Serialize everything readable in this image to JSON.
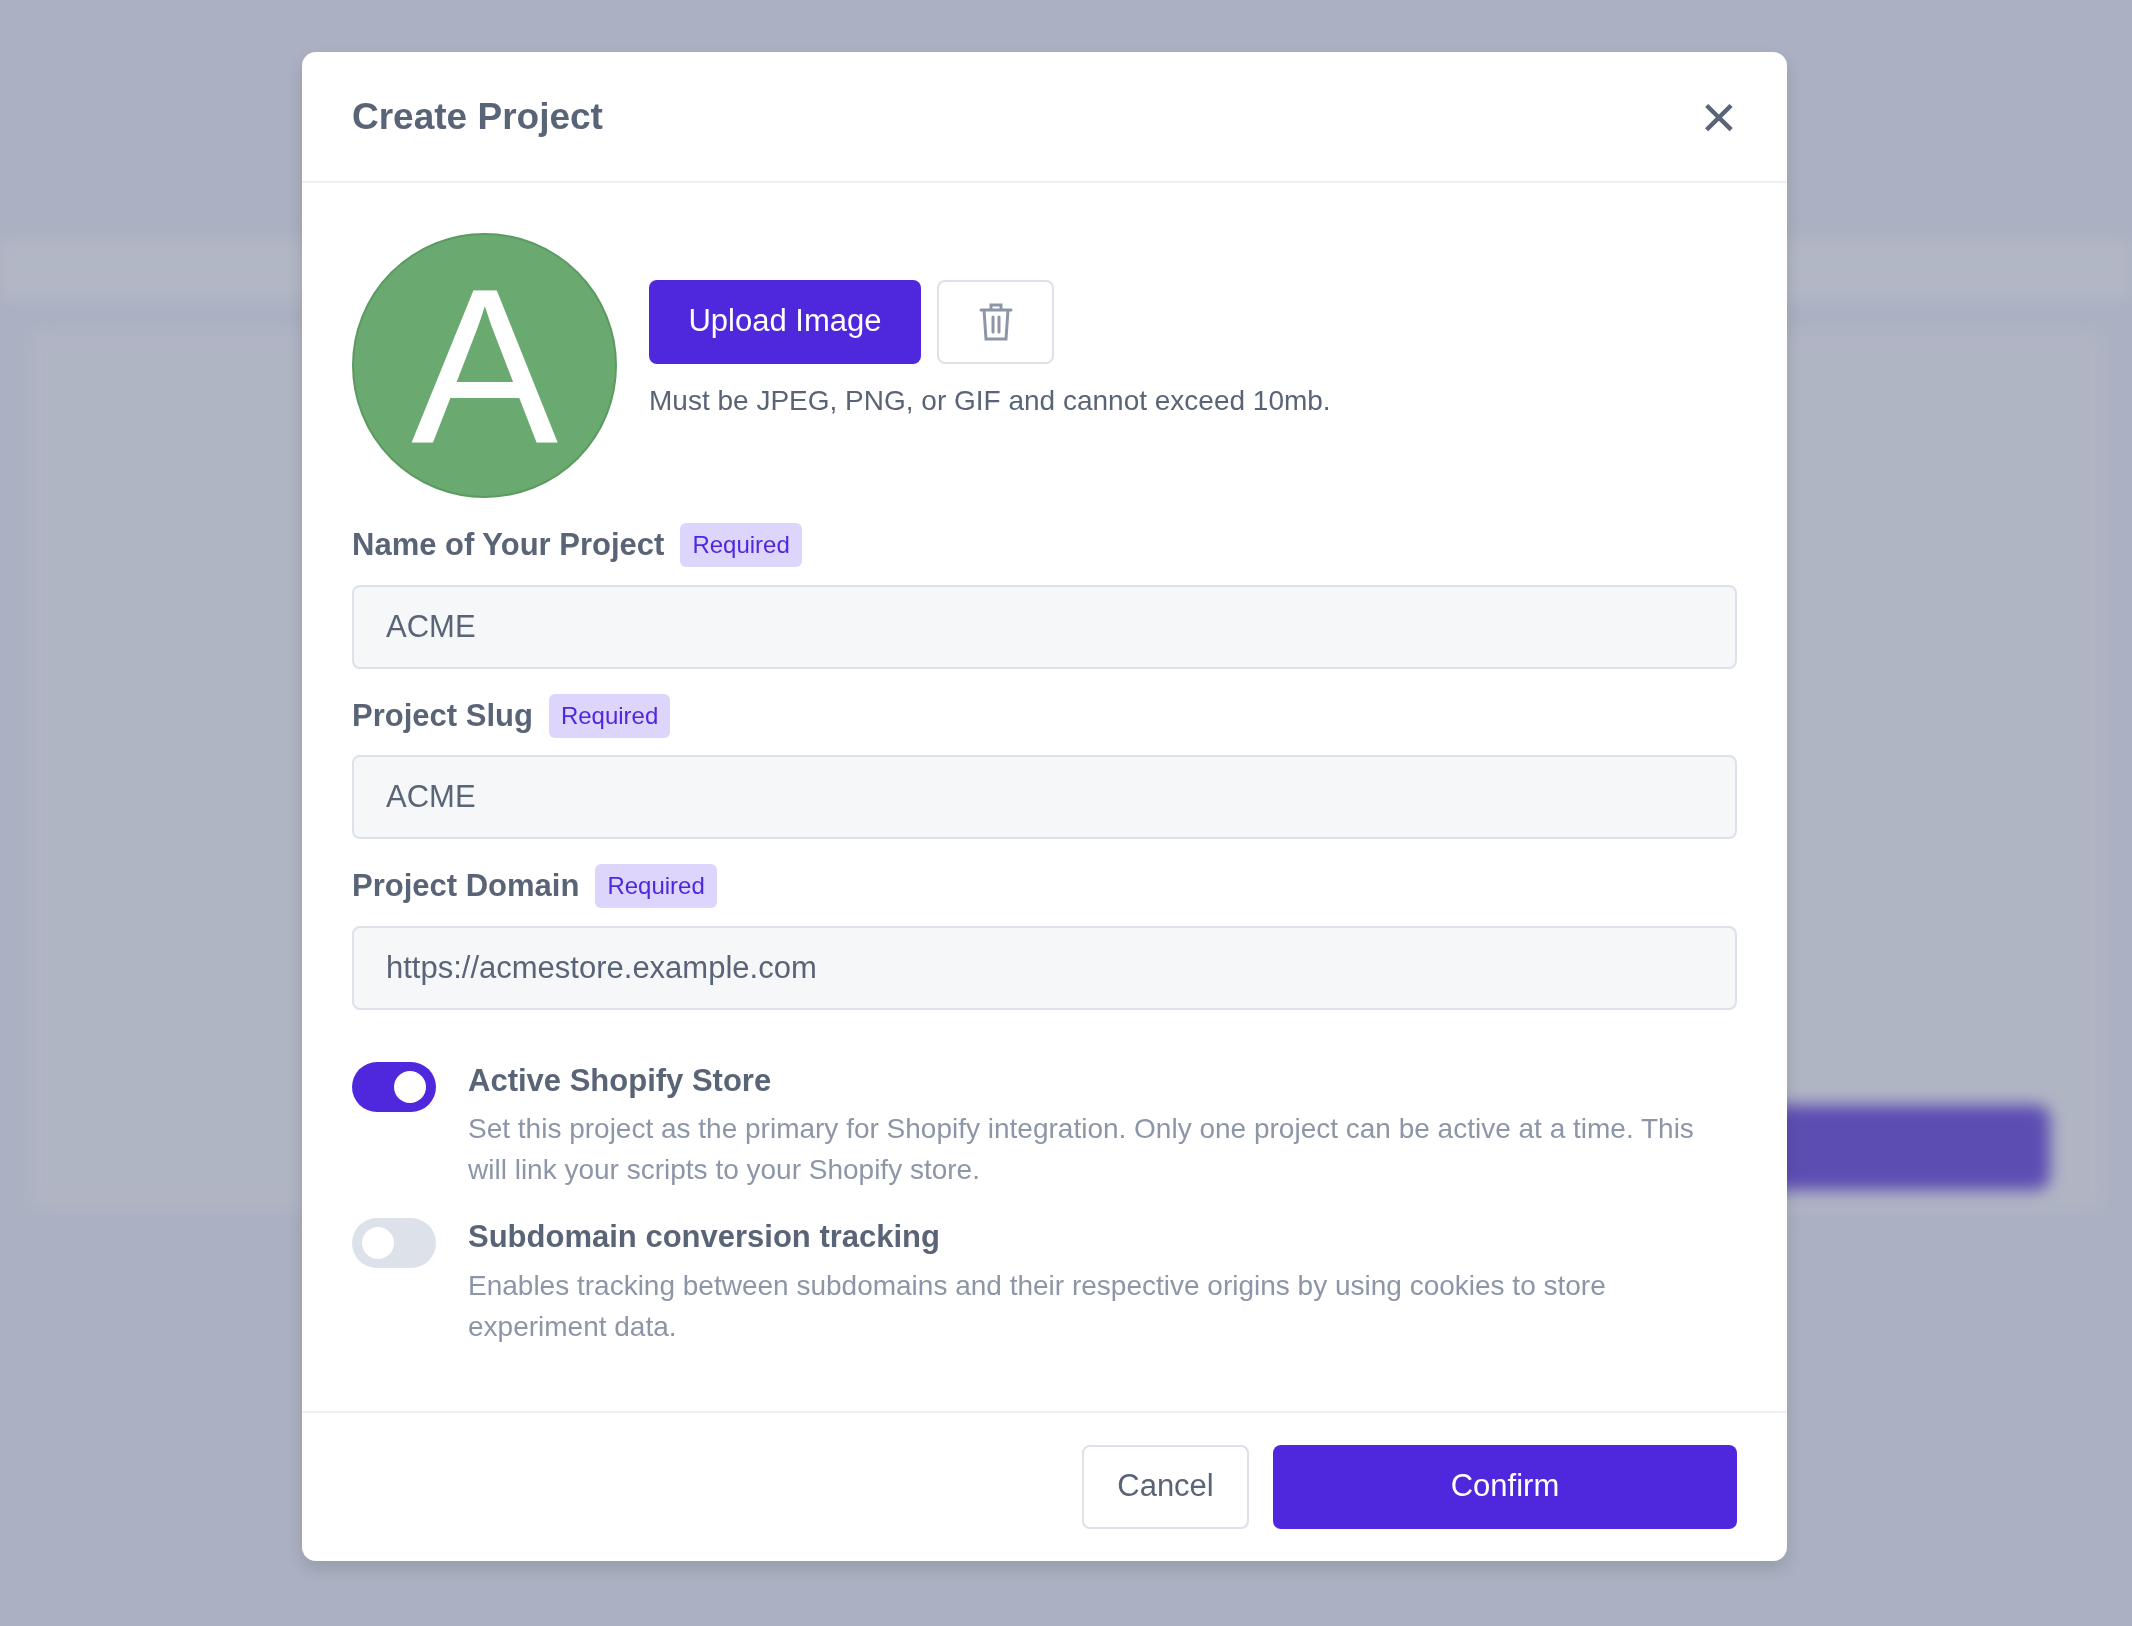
{
  "modal": {
    "title": "Create Project",
    "close": "×"
  },
  "avatar": {
    "letter": "A",
    "upload_button": "Upload Image",
    "hint": "Must be JPEG, PNG, or GIF and cannot exceed 10mb."
  },
  "fields": [
    {
      "label": "Name of Your Project",
      "badge": "Required",
      "value": "ACME"
    },
    {
      "label": "Project Slug",
      "badge": "Required",
      "value": "ACME"
    },
    {
      "label": "Project Domain",
      "badge": "Required",
      "value": "https://acmestore.example.com"
    }
  ],
  "toggles": [
    {
      "title": "Active Shopify Store",
      "description": "Set this project as the primary for Shopify integration. Only one project can be active at a time. This will link your scripts to your Shopify store.",
      "on": true
    },
    {
      "title": "Subdomain conversion tracking",
      "description": "Enables tracking between subdomains and their respective origins by using cookies to store experiment data.",
      "on": false
    }
  ],
  "buttons": [
    {
      "label": "Cancel",
      "kind": "secondary"
    },
    {
      "label": "Confirm",
      "kind": "primary"
    }
  ]
}
